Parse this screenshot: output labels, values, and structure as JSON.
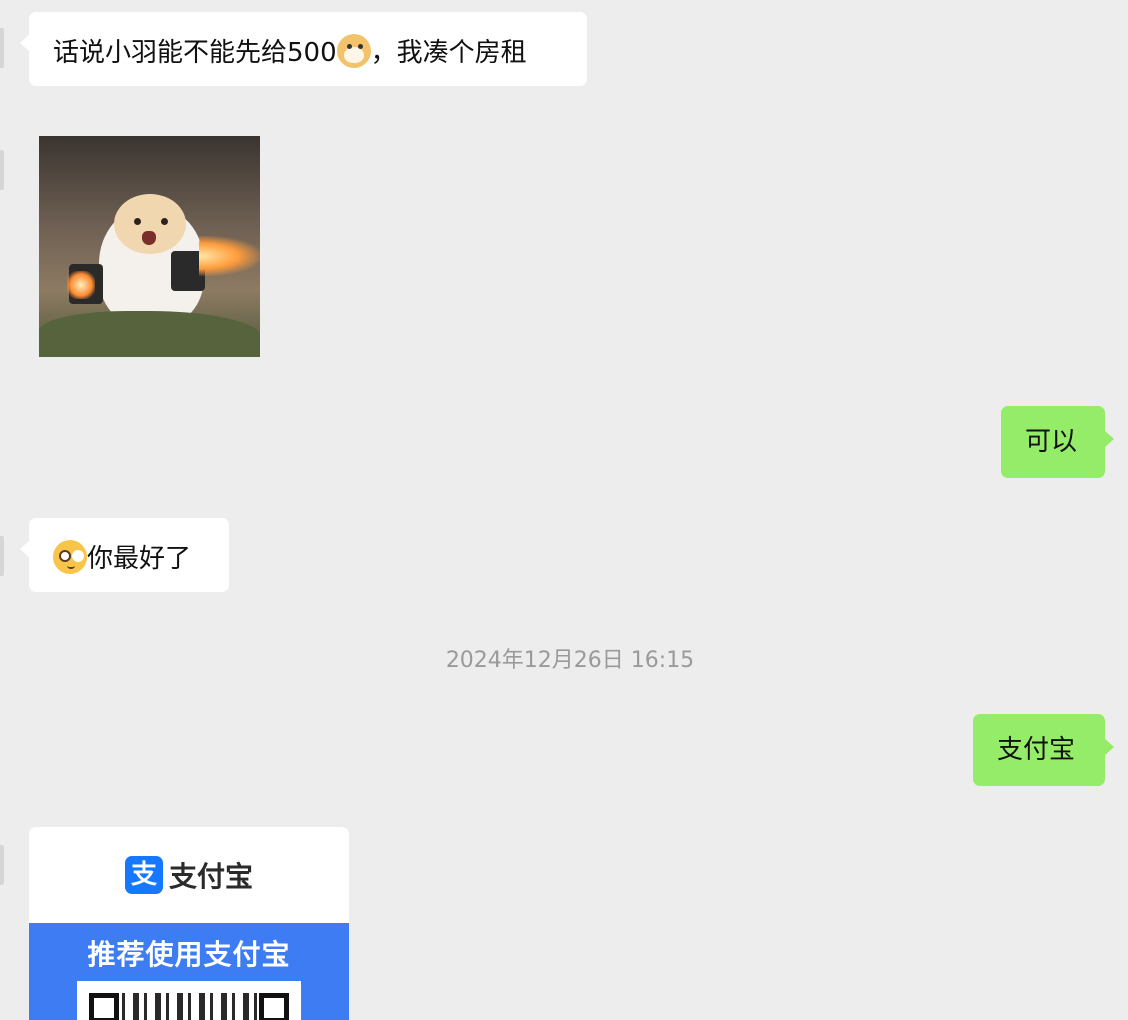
{
  "messages": [
    {
      "id": "m1",
      "side": "in",
      "text_before": "话说小羽能不能先给500",
      "emoji": "doge-icon",
      "text_after": "，我凑个房租"
    },
    {
      "id": "m2",
      "side": "in",
      "type": "sticker",
      "sticker": "hamster-sticker"
    },
    {
      "id": "m3",
      "side": "out",
      "text": "可以"
    },
    {
      "id": "m4",
      "side": "in",
      "emoji": "pleading-face-icon",
      "text": "你最好了"
    },
    {
      "id": "m5",
      "side": "out",
      "text": "支付宝"
    }
  ],
  "timestamp": "2024年12月26日 16:15",
  "payment_card": {
    "logo_mark": "支",
    "brand": "支付宝",
    "band_title": "推荐使用支付宝",
    "band_color": "#3d7cf3",
    "brand_color": "#1677ff"
  },
  "colors": {
    "background": "#ededed",
    "incoming_bubble": "#ffffff",
    "outgoing_bubble": "#95ec69"
  }
}
